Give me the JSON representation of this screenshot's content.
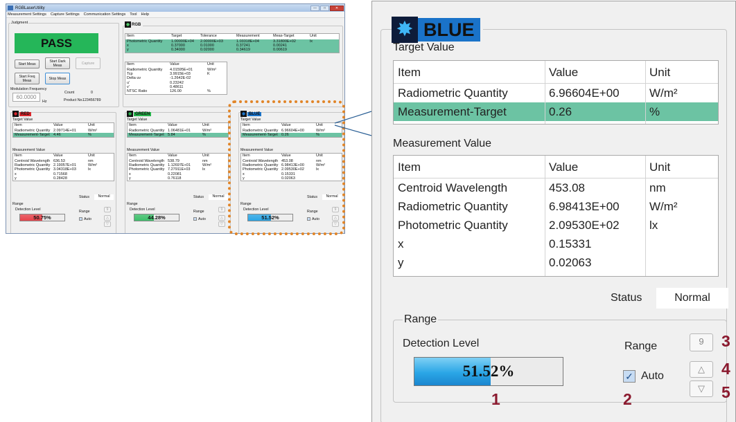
{
  "window": {
    "title": "RGBLaserUtility",
    "controls": [
      "—",
      "□",
      "✕"
    ],
    "menu": [
      "Measurement Settings",
      "Capture Settings",
      "Communication Settings",
      "Tool",
      "Help"
    ]
  },
  "judgment": {
    "label": "Judgment",
    "result": "PASS",
    "result_color": "#25b659",
    "buttons": {
      "start_meas": "Start Meas",
      "start_dark_meas": "Start Dark Meas",
      "capture": "Capture",
      "start_freq_meas": "Start Freq Meas",
      "stop_meas": "Stop Meas"
    },
    "modulation_label": "Modulation Frequency",
    "modulation_value": "60.0000",
    "modulation_unit": "Hz",
    "count_label": "Count",
    "count_value": "0",
    "product_label": "Product No.",
    "product_value": "123456789"
  },
  "rgb": {
    "name": "RGB",
    "target_headers": [
      "Item",
      "Target",
      "Tolerance",
      "Measurement",
      "Meas-Target",
      "Unit"
    ],
    "target_rows": [
      [
        "Photometric Quantity",
        "1.00000E+04",
        "2.00000E+03",
        "1.03318E+04",
        "3.31800E+02",
        "lx"
      ],
      [
        "x",
        "0.37000",
        "0.01000",
        "0.37241",
        "0.00241",
        ""
      ],
      [
        "y",
        "0.34000",
        "0.02000",
        "0.34619",
        "0.00619",
        ""
      ]
    ],
    "value_headers": [
      "Item",
      "Value",
      "Unit"
    ],
    "value_rows": [
      [
        "Radiometric Quantity",
        "4.01595E+01",
        "W/m²"
      ],
      [
        "Tcp",
        "3.9915E+03",
        "K"
      ],
      [
        "Delta uv",
        "-1.2642E-02",
        ""
      ],
      [
        "u'",
        "0.23242",
        ""
      ],
      [
        "v'",
        "0.48611",
        ""
      ],
      [
        "NTSC Ratio",
        "126.00",
        "%"
      ]
    ]
  },
  "channels": [
    {
      "key": "red",
      "name": "RED",
      "color": "#d9262c",
      "target_label": "Target Value",
      "target_headers": [
        "Item",
        "Value",
        "Unit"
      ],
      "target_rows": [
        [
          "Radiometric Quantity",
          "2.09714E+01",
          "W/m²"
        ],
        [
          "Measurement-Target",
          "4.46",
          "%"
        ]
      ],
      "meas_label": "Measurement Value",
      "meas_headers": [
        "Item",
        "Value",
        "Unit"
      ],
      "meas_rows": [
        [
          "Centroid Wavelength",
          "636.53",
          "nm"
        ],
        [
          "Radiometric Quantity",
          "2.19057E+01",
          "W/m²"
        ],
        [
          "Photometric Quantity",
          "3.04318E+03",
          "lx"
        ],
        [
          "x",
          "0.71568",
          ""
        ],
        [
          "y",
          "0.28428",
          ""
        ]
      ],
      "status_label": "Status",
      "status_value": "Normal",
      "range_label": "Range",
      "detection_label": "Detection Level",
      "level": 50.75,
      "level_text": "50.75%",
      "level_color": "#e8434b",
      "range_word": "Range",
      "range_value": "9",
      "auto_label": "Auto"
    },
    {
      "key": "green",
      "name": "GREEN",
      "color": "#25b24a",
      "target_label": "Target Value",
      "target_headers": [
        "Item",
        "Value",
        "Unit"
      ],
      "target_rows": [
        [
          "Radiometric Quantity",
          "1.06481E+01",
          "W/m²"
        ],
        [
          "Measurement-Target",
          "5.84",
          "%"
        ]
      ],
      "meas_label": "Measurement Value",
      "meas_headers": [
        "Item",
        "Value",
        "Unit"
      ],
      "meas_rows": [
        [
          "Centroid Wavelength",
          "538.79",
          "nm"
        ],
        [
          "Radiometric Quantity",
          "1.12697E+01",
          "W/m²"
        ],
        [
          "Photometric Quantity",
          "7.27911E+03",
          "lx"
        ],
        [
          "x",
          "0.22081",
          ""
        ],
        [
          "y",
          "0.76118",
          ""
        ]
      ],
      "status_label": "Status",
      "status_value": "Normal",
      "range_label": "Range",
      "detection_label": "Detection Level",
      "level": 44.28,
      "level_text": "44.28%",
      "level_color": "#3cc06a",
      "range_word": "Range",
      "range_value": "9",
      "auto_label": "Auto"
    },
    {
      "key": "blue",
      "name": "BLUE",
      "color": "#1a73c9",
      "target_label": "Target Value",
      "target_headers": [
        "Item",
        "Value",
        "Unit"
      ],
      "target_rows": [
        [
          "Radiometric Quantity",
          "6.96604E+00",
          "W/m²"
        ],
        [
          "Measurement-Target",
          "0.26",
          "%"
        ]
      ],
      "meas_label": "Measurement Value",
      "meas_headers": [
        "Item",
        "Value",
        "Unit"
      ],
      "meas_rows": [
        [
          "Centroid Wavelength",
          "453.08",
          "nm"
        ],
        [
          "Radiometric Quantity",
          "6.98413E+00",
          "W/m²"
        ],
        [
          "Photometric Quantity",
          "2.09530E+02",
          "lx"
        ],
        [
          "x",
          "0.15331",
          ""
        ],
        [
          "y",
          "0.02063",
          ""
        ]
      ],
      "status_label": "Status",
      "status_value": "Normal",
      "range_label": "Range",
      "detection_label": "Detection Level",
      "level": 51.52,
      "level_text": "51.52%",
      "level_color": "#2aa6e6",
      "range_word": "Range",
      "range_value": "9",
      "auto_label": "Auto"
    }
  ],
  "callouts": [
    "1",
    "2",
    "3",
    "4",
    "5"
  ],
  "icons": {
    "up": "△",
    "down": "▽",
    "check": "✓",
    "star": "✸"
  }
}
